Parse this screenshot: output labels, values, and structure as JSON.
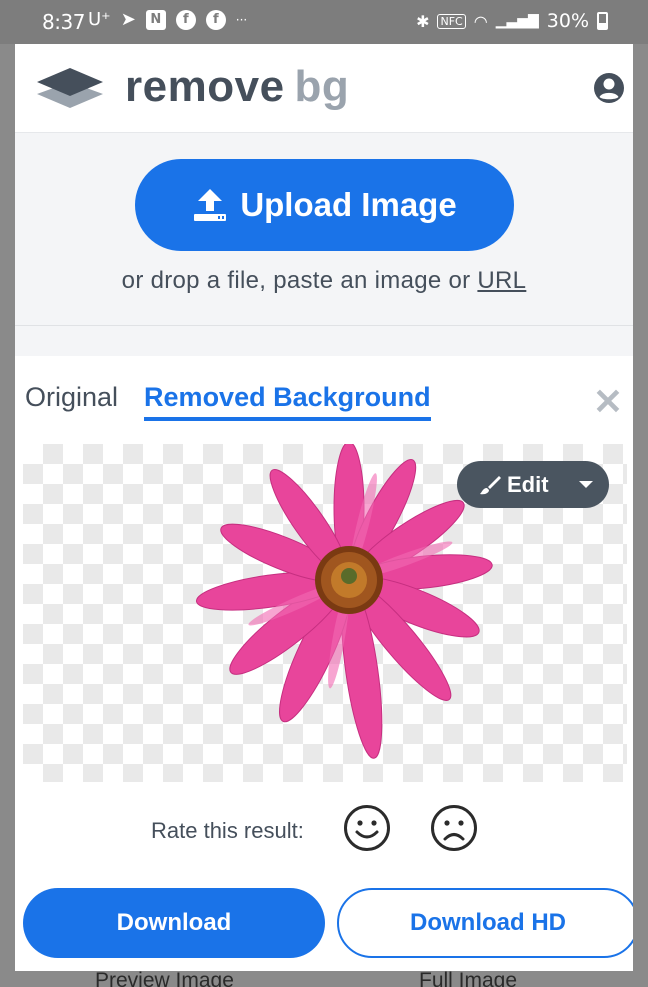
{
  "status_bar": {
    "time": "8:37",
    "carrier": "U⁺",
    "battery": "30%",
    "icons": [
      "telegram-icon",
      "news-icon",
      "facebook-icon",
      "facebook-icon",
      "more-icon"
    ],
    "right_icons": [
      "bluetooth-icon",
      "nfc-icon",
      "wifi-icon",
      "signal-icon",
      "battery-icon"
    ]
  },
  "header": {
    "logo_word": "remove",
    "logo_suffix": "bg",
    "account_icon": "account-icon"
  },
  "upload": {
    "button_label": "Upload Image",
    "drop_text": "or drop a file, paste an image or ",
    "url_link": "URL"
  },
  "result": {
    "tabs": [
      {
        "label": "Original",
        "active": false
      },
      {
        "label": "Removed Background",
        "active": true
      }
    ],
    "edit_label": "Edit",
    "rate_label": "Rate this result:",
    "download_label": "Download",
    "download_hd_label": "Download HD",
    "preview_caption": "Preview Image",
    "full_caption": "Full Image"
  },
  "colors": {
    "accent": "#1a73e8",
    "text": "#454f5b",
    "edit_bg": "#4a5560",
    "petal": "#e8459b",
    "center": "#a0561f"
  }
}
